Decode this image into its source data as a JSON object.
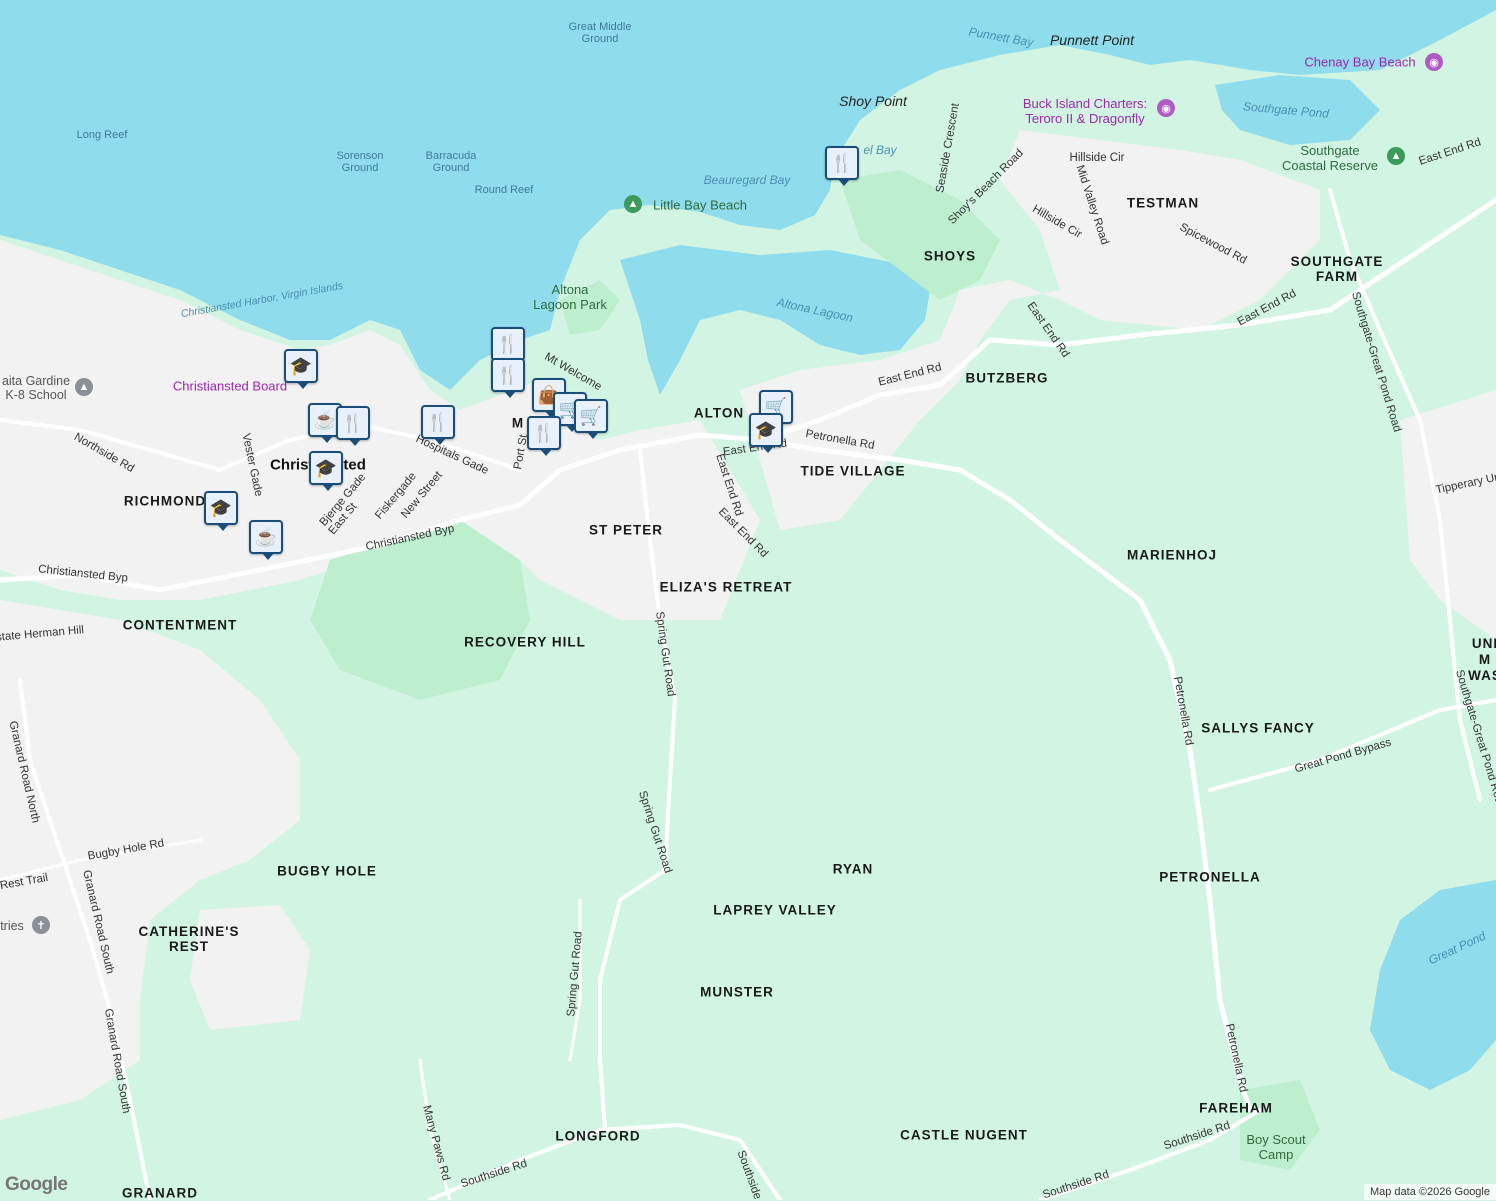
{
  "attribution": "Map data ©2026 Google",
  "logo": "Google",
  "colors": {
    "water": "#8fdcec",
    "land": "#d2f5e3",
    "urban": "#f2f2f2",
    "park": "#bdefcf",
    "road": "#ffffff",
    "marker": "#1a4d7a"
  },
  "water_labels": [
    {
      "text": "Great Middle",
      "text2": "Ground"
    },
    {
      "text": "Long Reef"
    },
    {
      "text": "Sorenson",
      "text2": "Ground"
    },
    {
      "text": "Barracuda",
      "text2": "Ground"
    },
    {
      "text": "Round Reef"
    },
    {
      "text": "Beauregard Bay"
    },
    {
      "text": "Punnett Bay"
    },
    {
      "text": "Christiansted Harbor, Virgin Islands"
    },
    {
      "text": "Altona Lagoon"
    },
    {
      "text": "Southgate Pond"
    },
    {
      "text": "Great Pond"
    },
    {
      "text": "el Bay"
    }
  ],
  "places": {
    "punnett_point": "Punnett Point",
    "shoy_point": "Shoy Point",
    "shoys": "SHOYS",
    "testman": "TESTMAN",
    "southgate_farm_1": "SOUTHGATE",
    "southgate_farm_2": "FARM",
    "butzberg": "BUTZBERG",
    "tide_village": "TIDE VILLAGE",
    "altona": "ALTON",
    "marienhoj": "MARIENHOJ",
    "st_peter": "ST PETER",
    "elizas_retreat": "ELIZA'S RETREAT",
    "richmond": "RICHMOND",
    "contentment": "CONTENTMENT",
    "recovery_hill": "RECOVERY HILL",
    "sallys_fancy": "SALLYS FANCY",
    "bugby_hole": "BUGBY HOLE",
    "ryan": "RYAN",
    "petronella": "PETRONELLA",
    "laprey_valley": "LAPREY VALLEY",
    "catherines_rest_1": "CATHERINE'S",
    "catherines_rest_2": "REST",
    "munster": "MUNSTER",
    "longford": "LONGFORD",
    "castle_nugent": "CASTLE NUGENT",
    "fareham": "FAREHAM",
    "granard": "GRANARD",
    "christiansted": "Christiansted",
    "m_label": "M",
    "un_1": "UNI",
    "un_2": "M",
    "un_3": "WAS"
  },
  "pois": {
    "chenay": "Chenay Bay Beach",
    "buck_island_1": "Buck Island Charters:",
    "buck_island_2": "Teroro II & Dragonfly",
    "southgate_reserve_1": "Southgate",
    "southgate_reserve_2": "Coastal Reserve",
    "little_bay": "Little Bay Beach",
    "altona_park_1": "Altona",
    "altona_park_2": "Lagoon Park",
    "christiansted_board": "Christiansted Board",
    "school_1": "aita Gardine",
    "school_2": "K-8 School",
    "boy_scout_1": "Boy Scout",
    "boy_scout_2": "Camp",
    "tries": "tries"
  },
  "roads": {
    "east_end_rd": "East End Rd",
    "petronella_rd": "Petronella Rd",
    "hillside_cir": "Hillside Cir",
    "mid_valley": "Mid Valley Road",
    "seaside": "Seaside Crescent",
    "shoys_beach": "Shoy's Beach Road",
    "spicewood": "Spicewood Rd",
    "southgate_great_pond": "Southgate-Great Pond Road",
    "tipperary": "Tipperary Ur",
    "great_pond_bypass": "Great Pond Bypass",
    "spring_gut": "Spring Gut Road",
    "southside": "Southside Rd",
    "many_paws": "Many Paws Rd",
    "granard_north": "Granard Road North",
    "granard_south": "Granard Road South",
    "bugby_hole_rd": "Bugby Hole Rd",
    "rest_trail": "Rest Trail",
    "northside": "Northside Rd",
    "christiansted_byp": "Christiansted Byp",
    "hospitals_gade": "Hospitals Gade",
    "port_st": "Port St",
    "mt_welcome": "Mt Welcome",
    "vester_gade": "Vester Gade",
    "bjerge_gade": "Bjerge Gade",
    "east_st": "East St",
    "fiskergade": "Fiskergade",
    "new_street": "New Street",
    "state_herman": "state Herman Hill",
    "petronella_rd_n": "Petronella Rd",
    "southside_2": "Southside Rd",
    "southside_3": "Southside Rd",
    "southside_4": "Southside Rd",
    "southside_5": "Southside"
  },
  "markers": [
    {
      "icon": "fork-knife-icon",
      "glyph": "🍴"
    },
    {
      "icon": "fork-knife-icon",
      "glyph": "🍴"
    },
    {
      "icon": "fork-knife-icon",
      "glyph": "🍴"
    },
    {
      "icon": "school-icon",
      "glyph": "🎓"
    },
    {
      "icon": "shopping-bag-icon",
      "glyph": "👜"
    },
    {
      "icon": "cart-icon",
      "glyph": "🛒"
    },
    {
      "icon": "cart-icon",
      "glyph": "🛒"
    },
    {
      "icon": "coffee-icon",
      "glyph": "☕"
    },
    {
      "icon": "fork-knife-icon",
      "glyph": "🍴"
    },
    {
      "icon": "school-icon",
      "glyph": "🎓"
    },
    {
      "icon": "school-icon",
      "glyph": "🎓"
    },
    {
      "icon": "coffee-icon",
      "glyph": "☕"
    },
    {
      "icon": "fork-knife-icon",
      "glyph": "🍴"
    },
    {
      "icon": "cart-icon",
      "glyph": "🛒"
    },
    {
      "icon": "school-icon",
      "glyph": "🎓"
    },
    {
      "icon": "fork-knife-icon",
      "glyph": "🍴"
    }
  ]
}
